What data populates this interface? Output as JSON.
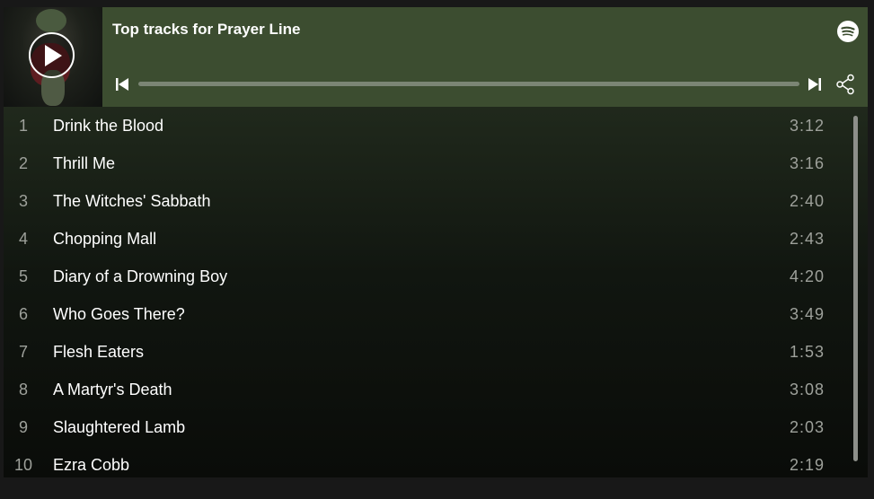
{
  "header": {
    "title": "Top tracks for Prayer Line"
  },
  "icons": {
    "play": "play-icon",
    "spotify": "spotify-logo-icon",
    "previous": "skip-previous-icon",
    "next": "skip-next-icon",
    "share": "share-icon"
  },
  "player": {
    "progress": 0
  },
  "tracks": [
    {
      "num": "1",
      "name": "Drink the Blood",
      "duration": "3:12"
    },
    {
      "num": "2",
      "name": "Thrill Me",
      "duration": "3:16"
    },
    {
      "num": "3",
      "name": "The Witches' Sabbath",
      "duration": "2:40"
    },
    {
      "num": "4",
      "name": "Chopping Mall",
      "duration": "2:43"
    },
    {
      "num": "5",
      "name": "Diary of a Drowning Boy",
      "duration": "4:20"
    },
    {
      "num": "6",
      "name": "Who Goes There?",
      "duration": "3:49"
    },
    {
      "num": "7",
      "name": "Flesh Eaters",
      "duration": "1:53"
    },
    {
      "num": "8",
      "name": "A Martyr's Death",
      "duration": "3:08"
    },
    {
      "num": "9",
      "name": "Slaughtered Lamb",
      "duration": "2:03"
    },
    {
      "num": "10",
      "name": "Ezra Cobb",
      "duration": "2:19"
    }
  ],
  "colors": {
    "header_bg": "#3c4d30",
    "accent": "#ffffff"
  }
}
